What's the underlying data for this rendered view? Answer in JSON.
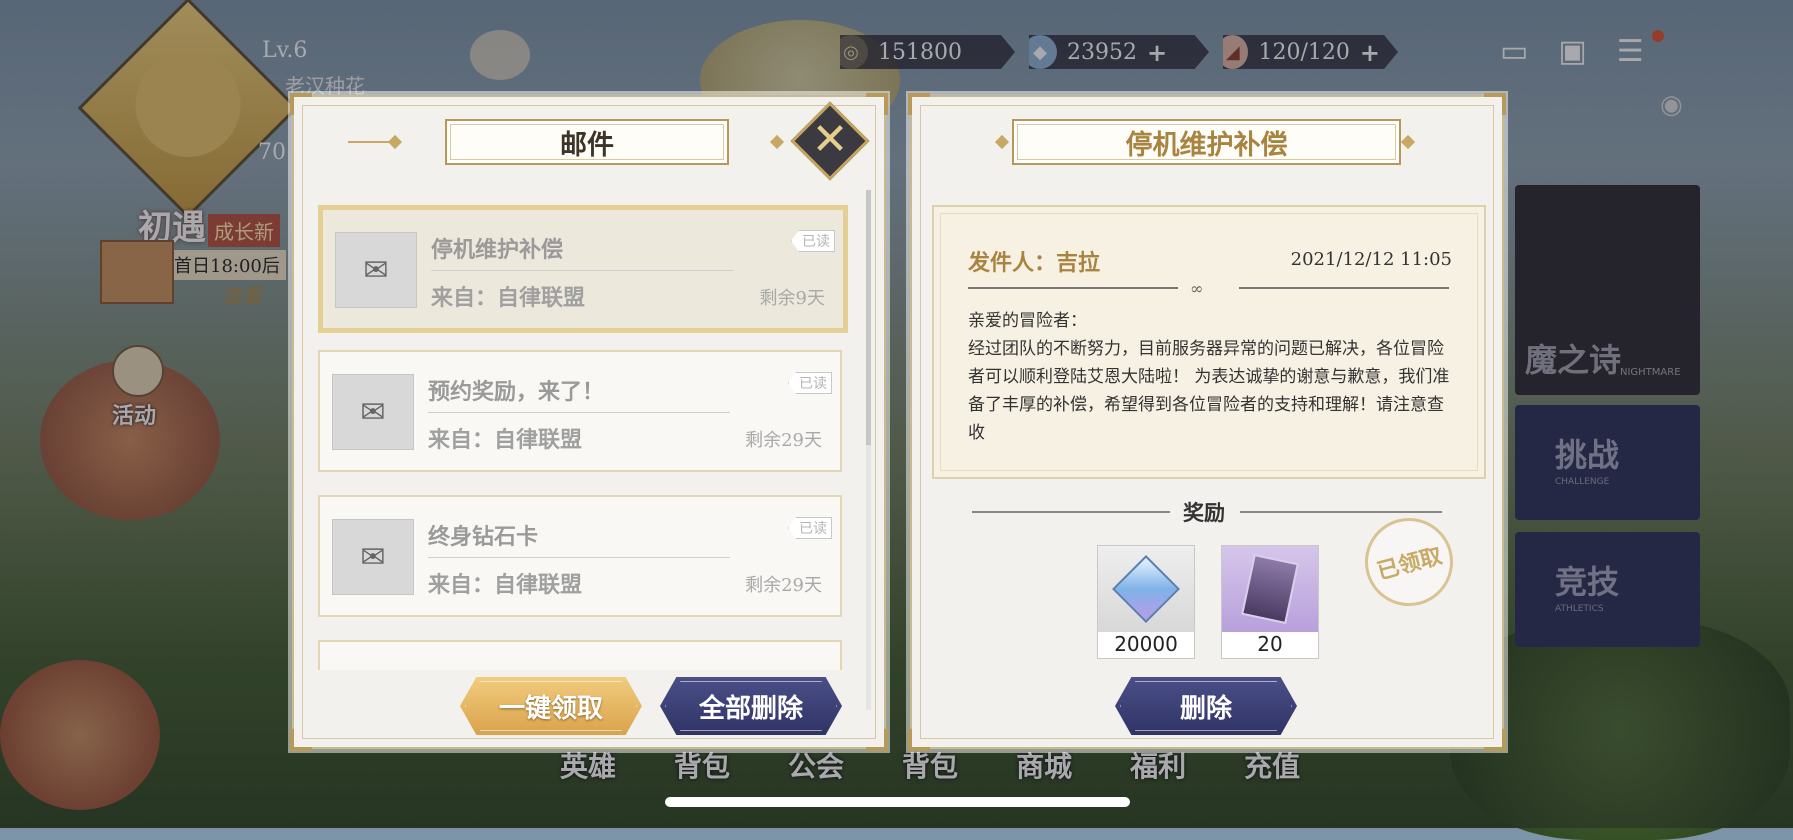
{
  "hud": {
    "level": "Lv.6",
    "player_name_partial": "老汉种花",
    "power_partial": "70",
    "event_title": "初遇",
    "event_badge": "成长新",
    "event_time": "首日18:00后",
    "event_link": "查看",
    "activity_label": "活动"
  },
  "resources": [
    {
      "icon": "coin-icon",
      "value": "151800",
      "plus": ""
    },
    {
      "icon": "diamond-icon",
      "value": "23952",
      "plus": "+"
    },
    {
      "icon": "stamina-icon",
      "value": "120/120",
      "plus": "+"
    }
  ],
  "right_menu": {
    "nightmare": "魔之诗",
    "nightmare_sub": "NIGHTMARE",
    "challenge": "挑战",
    "challenge_sub": "CHALLENGE",
    "athletics": "竞技",
    "athletics_sub": "ATHLETICS"
  },
  "bottom_nav": [
    "英雄",
    "背包",
    "公会",
    "背包",
    "商城",
    "福利",
    "充值"
  ],
  "mail_panel": {
    "title": "邮件",
    "close_glyph": "✕",
    "mails": [
      {
        "title": "停机维护补偿",
        "from": "来自：自律联盟",
        "remaining": "剩余9天",
        "tag": "已读"
      },
      {
        "title": "预约奖励，来了！",
        "from": "来自：自律联盟",
        "remaining": "剩余29天",
        "tag": "已读"
      },
      {
        "title": "终身钻石卡",
        "from": "来自：自律联盟",
        "remaining": "剩余29天",
        "tag": "已读"
      }
    ],
    "claim_all_label": "一键领取",
    "delete_all_label": "全部删除"
  },
  "detail_panel": {
    "title": "停机维护补偿",
    "sender": "发件人：吉拉",
    "date": "2021/12/12 11:05",
    "body": [
      "亲爱的冒险者：",
      "经过团队的不断努力，目前服务器异常的问题已解决，各位冒险者可以顺利登陆艾恩大陆啦！ 为表达诚挚的谢意与歉意，我们准备了丰厚的补偿，希望得到各位冒险者的支持和理解！请注意查收"
    ],
    "reward_label": "奖励",
    "rewards": [
      {
        "icon": "diamond-crystal-icon",
        "qty": "20000"
      },
      {
        "icon": "ticket-card-icon",
        "qty": "20"
      }
    ],
    "claimed_stamp": "已领取",
    "delete_label": "删除"
  },
  "colors": {
    "gold": "#a98440",
    "navy": "#2f3366",
    "panel_bg": "#f3f1ee"
  }
}
